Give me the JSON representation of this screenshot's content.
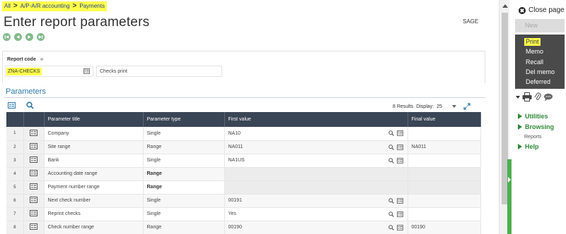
{
  "breadcrumb": {
    "items": [
      "All",
      "A/P-A/R accounting",
      "Payments"
    ],
    "separator": ">"
  },
  "page": {
    "title": "Enter report parameters",
    "folder": "SAGE"
  },
  "report_code": {
    "label": "Report code",
    "value": "ZNA-CHECKS",
    "description": "Checks print"
  },
  "parameters": {
    "section_title": "Parameters",
    "results": "8 Results",
    "display_label": "Display:",
    "display_value": "25",
    "columns": [
      "Parameter title",
      "Parameter type",
      "First value",
      "Final value"
    ],
    "rows": [
      {
        "num": "1",
        "title": "Company",
        "type": "Single",
        "first": "NA10",
        "final": "",
        "bold": false
      },
      {
        "num": "2",
        "title": "Site range",
        "type": "Range",
        "first": "NA011",
        "final": "NA011",
        "bold": false
      },
      {
        "num": "3",
        "title": "Bank",
        "type": "Single",
        "first": "NA1US",
        "final": "",
        "bold": false
      },
      {
        "num": "4",
        "title": "Accounting date range",
        "type": "Range",
        "first": "",
        "final": "",
        "bold": true
      },
      {
        "num": "5",
        "title": "Payment number range",
        "type": "Range",
        "first": "",
        "final": "",
        "bold": true
      },
      {
        "num": "6",
        "title": "Next check number",
        "type": "Single",
        "first": "00191",
        "final": "",
        "bold": false
      },
      {
        "num": "7",
        "title": "Reprint checks",
        "type": "Single",
        "first": "Yes",
        "final": "",
        "bold": false
      },
      {
        "num": "8",
        "title": "Check number range",
        "type": "Range",
        "first": "00190",
        "final": "00190",
        "bold": false
      }
    ]
  },
  "right_panel": {
    "close_label": "Close page",
    "new_label": "New",
    "actions": [
      "Print",
      "Memo",
      "Recall",
      "Del memo",
      "Deferred"
    ],
    "links": [
      "Utilities",
      "Browsing",
      "Help"
    ],
    "browsing_sub": "Reports"
  },
  "colors": {
    "highlight": "#ffff4d",
    "grid_header": "#3a4555",
    "accent_blue": "#2e7aa8",
    "link_green": "#2f8a3a",
    "action_menu_bg": "#4a4a4a"
  }
}
